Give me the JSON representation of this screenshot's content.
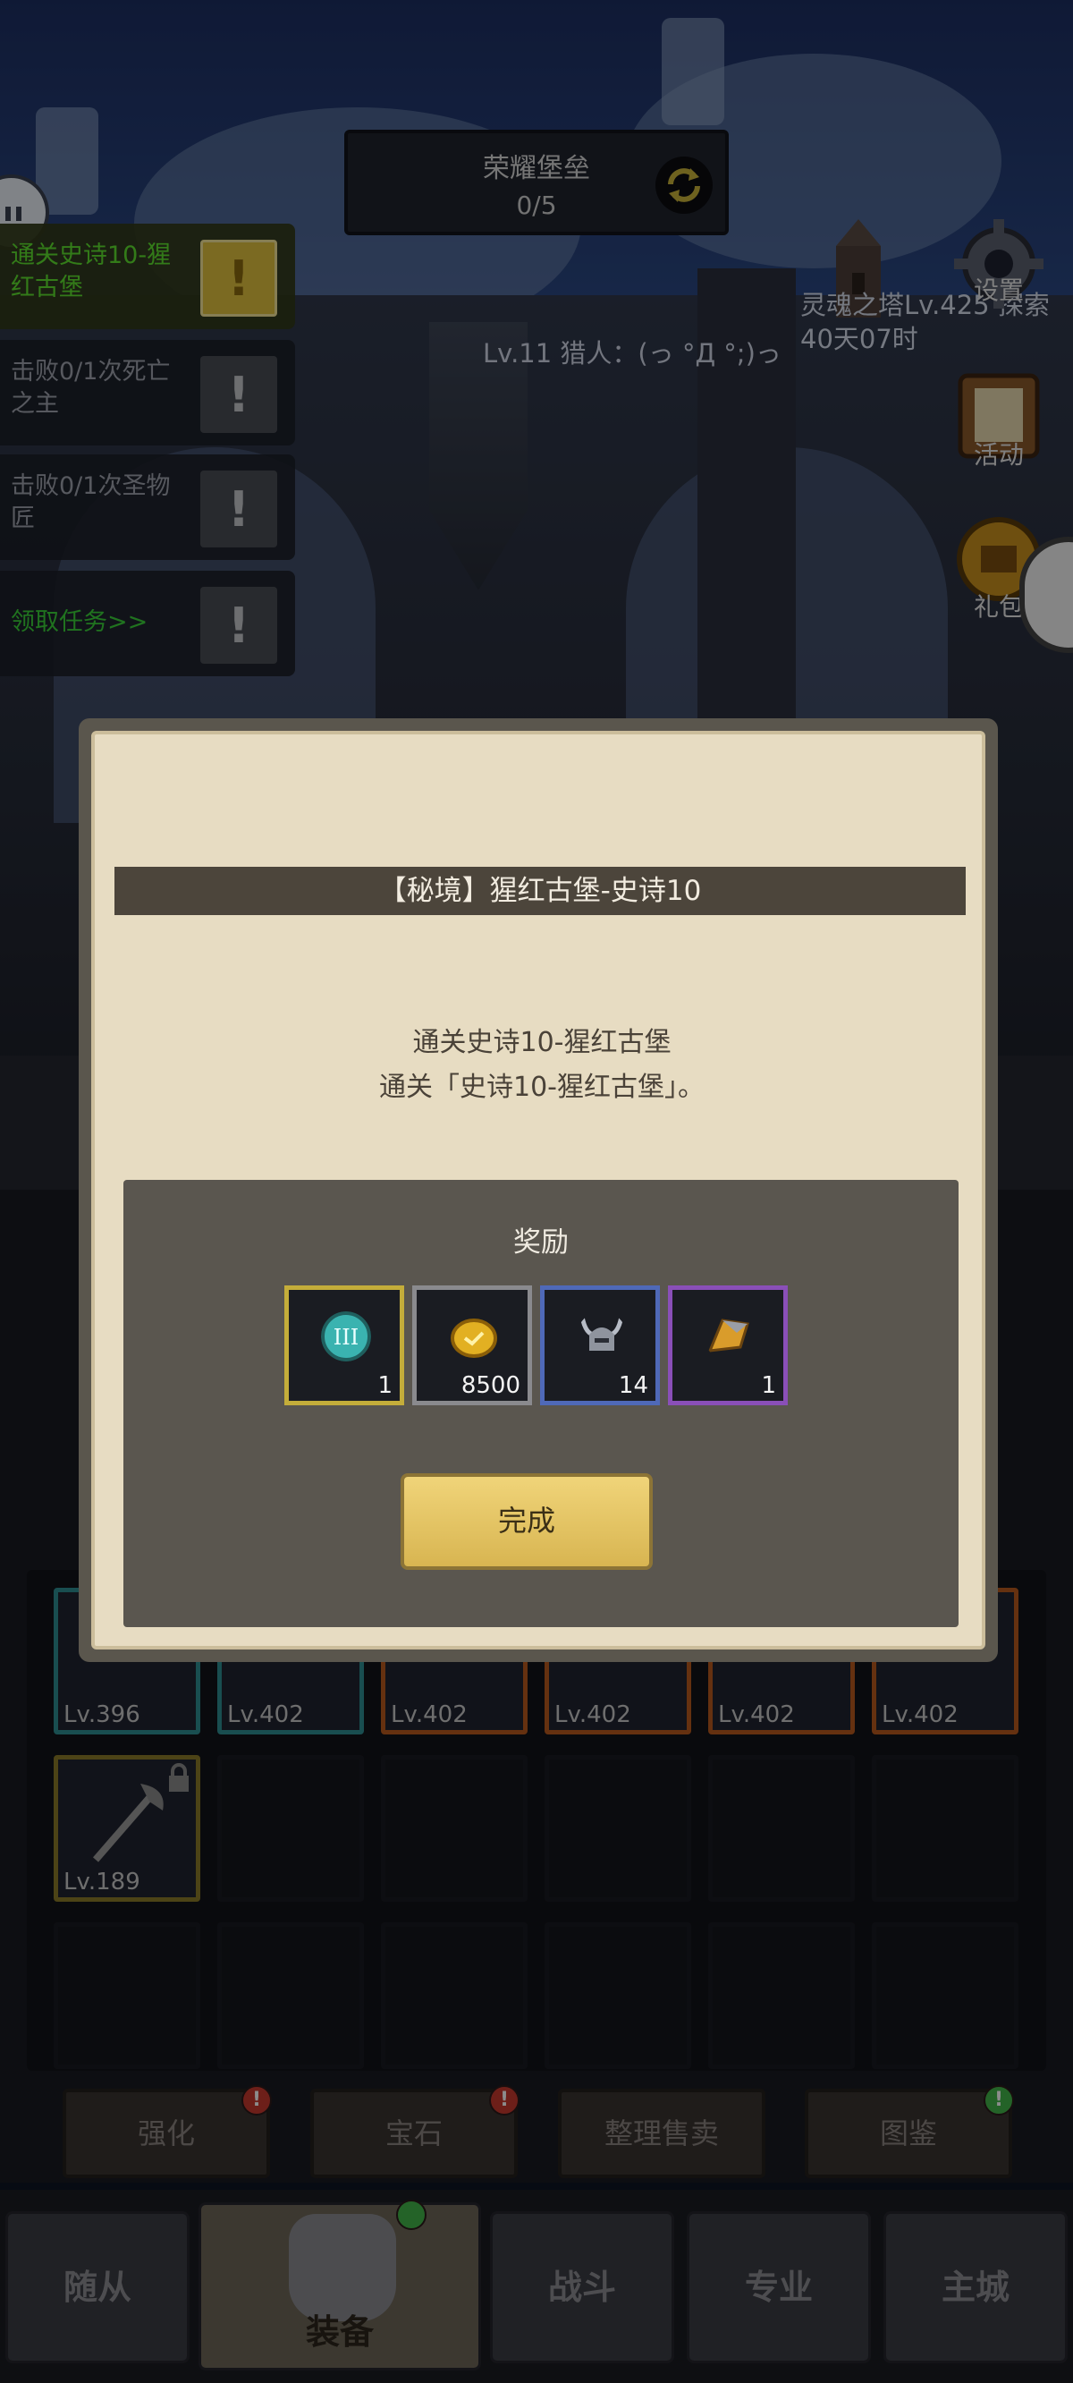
{
  "fortress": {
    "name": "荣耀堡垒",
    "progress": "0/5"
  },
  "player": {
    "status": "Lv.11 猎人：(っ °Д °;)っ"
  },
  "soul_tower": {
    "line1": "灵魂之塔Lv.425 探索",
    "line2": "40天07时"
  },
  "side_buttons": {
    "settings": "设置",
    "activity": "活动",
    "gift": "礼包"
  },
  "quests": [
    {
      "text": "通关史诗10-猩红古堡",
      "state": "active"
    },
    {
      "text": "击败0/1次死亡之主",
      "state": "pending"
    },
    {
      "text": "击败0/1次圣物匠",
      "state": "pending"
    },
    {
      "text": "领取任务>>",
      "state": "claim"
    }
  ],
  "modal": {
    "title": "【秘境】猩红古堡-史诗10",
    "desc_line1": "通关史诗10-猩红古堡",
    "desc_line2": "通关「史诗10-猩红古堡」。",
    "reward_title": "奖励",
    "rewards": [
      {
        "icon": "tier-3-medal-icon",
        "qty": "1",
        "quality": "gold"
      },
      {
        "icon": "gold-coin-icon",
        "qty": "8500",
        "quality": "gray"
      },
      {
        "icon": "horned-helmet-icon",
        "qty": "14",
        "quality": "blue"
      },
      {
        "icon": "ore-shard-icon",
        "qty": "1",
        "quality": "purple"
      }
    ],
    "confirm": "完成"
  },
  "equipment_slots": [
    {
      "level": "Lv.396",
      "color": "teal"
    },
    {
      "level": "Lv.402",
      "color": "teal"
    },
    {
      "level": "Lv.402",
      "color": "orange"
    },
    {
      "level": "Lv.402",
      "color": "orange"
    },
    {
      "level": "Lv.402",
      "color": "orange"
    },
    {
      "level": "Lv.402",
      "color": "orange"
    },
    {
      "level": "Lv.189",
      "color": "gold"
    }
  ],
  "function_buttons": [
    {
      "label": "强化",
      "badge": "!",
      "badge_color": "red"
    },
    {
      "label": "宝石",
      "badge": "!",
      "badge_color": "red"
    },
    {
      "label": "整理售卖"
    },
    {
      "label": "图鉴",
      "badge": "!",
      "badge_color": "green"
    }
  ],
  "nav_tabs": [
    "随从",
    "装备",
    "战斗",
    "专业",
    "主城"
  ],
  "colors": {
    "accent_gold": "#e1c23e",
    "quest_green": "#5de12f",
    "paper": "#e7dcc2"
  }
}
